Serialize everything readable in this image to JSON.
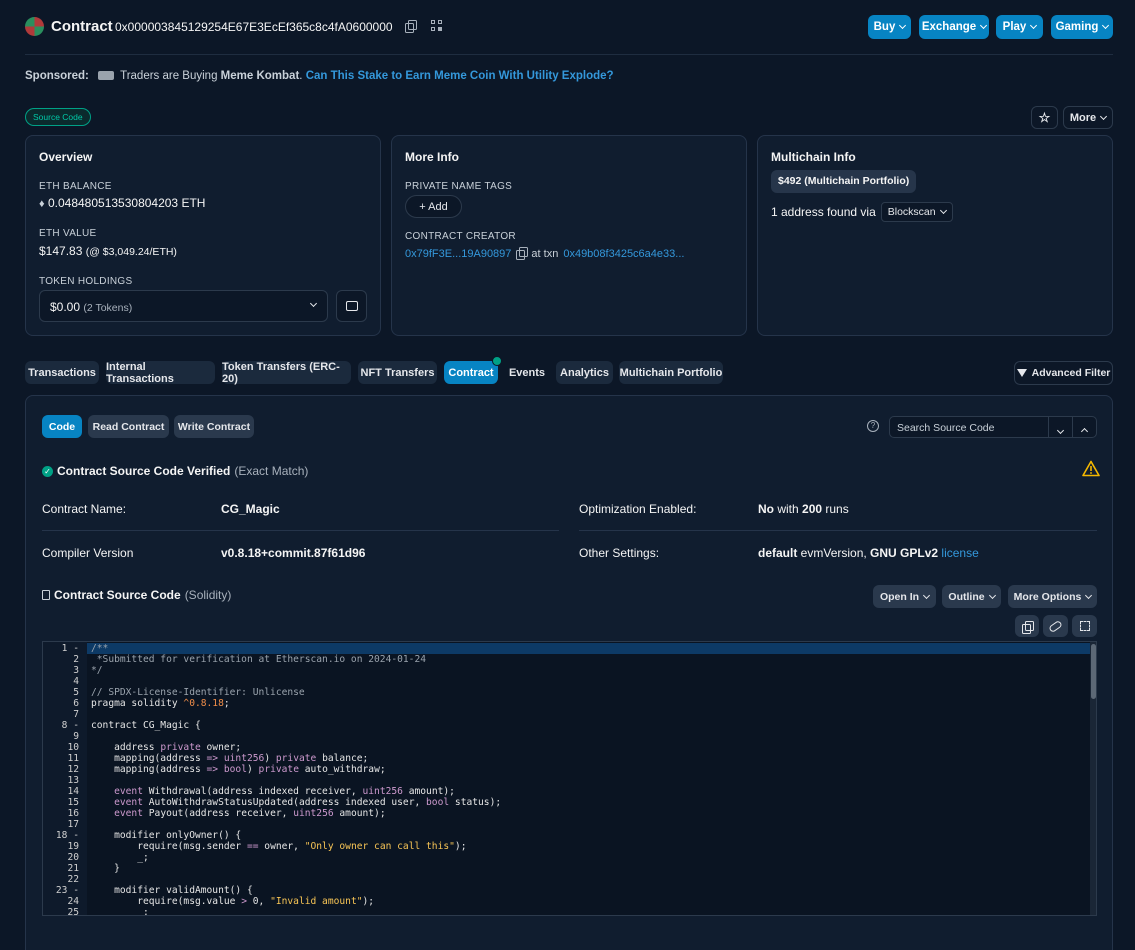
{
  "header": {
    "title": "Contract",
    "address": "0x000003845129254E67E3EcEf365c8c4fA0600000",
    "nav": [
      "Buy",
      "Exchange",
      "Play",
      "Gaming"
    ]
  },
  "sponsored": {
    "label": "Sponsored:",
    "text_a": "Traders are Buying ",
    "text_bold": "Meme Kombat",
    "text_b": ".",
    "link": "Can This Stake to Earn Meme Coin With Utility Explode?"
  },
  "badge": "Source Code",
  "more_label": "More",
  "overview": {
    "title": "Overview",
    "eth_balance_label": "ETH BALANCE",
    "eth_balance": "0.048480513530804203 ETH",
    "eth_value_label": "ETH VALUE",
    "eth_value": "$147.83",
    "eth_price": "(@ $3,049.24/ETH)",
    "token_label": "TOKEN HOLDINGS",
    "token_value": "$0.00",
    "token_count": "(2 Tokens)"
  },
  "more_info": {
    "title": "More Info",
    "tags_label": "PRIVATE NAME TAGS",
    "add_label": "+ Add",
    "creator_label": "CONTRACT CREATOR",
    "creator": "0x79fF3E...19A90897",
    "at_txn": "at txn",
    "txn": "0x49b08f3425c6a4e33..."
  },
  "multichain": {
    "title": "Multichain Info",
    "portfolio": "$492 (Multichain Portfolio)",
    "found": "1 address found via",
    "via": "Blockscan"
  },
  "tabs": [
    "Transactions",
    "Internal Transactions",
    "Token Transfers (ERC-20)",
    "NFT Transfers",
    "Contract",
    "Events",
    "Analytics",
    "Multichain Portfolio"
  ],
  "advanced_filter": "Advanced Filter",
  "subtabs": [
    "Code",
    "Read Contract",
    "Write Contract"
  ],
  "search_placeholder": "Search Source Code",
  "verified": {
    "text": "Contract Source Code Verified",
    "match": "(Exact Match)"
  },
  "details": {
    "name_label": "Contract Name:",
    "name": "CG_Magic",
    "opt_label": "Optimization Enabled:",
    "opt_a": "No",
    "opt_b": " with ",
    "opt_c": "200",
    "opt_d": " runs",
    "compiler_label": "Compiler Version",
    "compiler": "v0.8.18+commit.87f61d96",
    "other_label": "Other Settings:",
    "other_a": "default",
    "other_b": " evmVersion, ",
    "other_c": "GNU GPLv2",
    "other_link": "license"
  },
  "source": {
    "title": "Contract Source Code",
    "lang": "(Solidity)",
    "open_in": "Open In",
    "outline": "Outline",
    "more_options": "More Options"
  },
  "code_lines": [
    "/**",
    " *Submitted for verification at Etherscan.io on 2024-01-24",
    "*/",
    "",
    "// SPDX-License-Identifier: Unlicense",
    "pragma solidity ^0.8.18;",
    "",
    "contract CG_Magic {",
    "",
    "    address private owner;",
    "    mapping(address => uint256) private balance;",
    "    mapping(address => bool) private auto_withdraw;",
    "",
    "    event Withdrawal(address indexed receiver, uint256 amount);",
    "    event AutoWithdrawStatusUpdated(address indexed user, bool status);",
    "    event Payout(address receiver, uint256 amount);",
    "",
    "    modifier onlyOwner() {",
    "        require(msg.sender == owner, \"Only owner can call this\");",
    "        _;",
    "    }",
    "",
    "    modifier validAmount() {",
    "        require(msg.value > 0, \"Invalid amount\");",
    "        _;"
  ],
  "colors": {
    "accent": "#0784c3",
    "bg": "#0c1727",
    "card": "#101d2f",
    "success": "#00a186",
    "warning": "#f5b800"
  }
}
